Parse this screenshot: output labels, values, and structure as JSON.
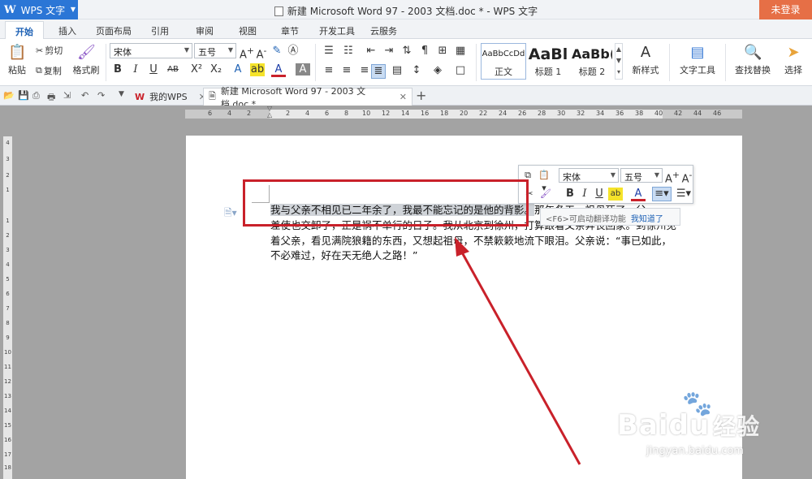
{
  "titlebar": {
    "app_name": "WPS 文字",
    "app_logo": "W",
    "doc_title": "新建 Microsoft Word 97 - 2003 文档.doc * - WPS 文字",
    "login": "未登录"
  },
  "menu": {
    "tabs": [
      "开始",
      "插入",
      "页面布局",
      "引用",
      "审阅",
      "视图",
      "章节",
      "开发工具",
      "云服务"
    ]
  },
  "ribbon": {
    "paste": "粘贴",
    "cut": "剪切",
    "copy": "复制",
    "format_painter": "格式刷",
    "font_name": "宋体",
    "font_size": "五号",
    "bold": "B",
    "italic": "I",
    "underline": "U",
    "styles": [
      {
        "preview": "AaBbCcDd",
        "name": "正文"
      },
      {
        "preview": "AaBl",
        "name": "标题 1"
      },
      {
        "preview": "AaBb(",
        "name": "标题 2"
      }
    ],
    "new_style": "新样式",
    "text_tools": "文字工具",
    "find_replace": "查找替换",
    "select": "选择"
  },
  "doc_tabs": [
    {
      "label": "我的WPS",
      "active": false
    },
    {
      "label": "新建 Microsoft Word 97 - 2003 文档.doc *",
      "active": true
    }
  ],
  "ruler": {
    "h_ticks": [
      "6",
      "4",
      "2",
      "",
      "2",
      "4",
      "6",
      "8",
      "10",
      "12",
      "14",
      "16",
      "18",
      "20",
      "22",
      "24",
      "26",
      "28",
      "30",
      "32",
      "34",
      "36",
      "38",
      "40",
      "42",
      "44",
      "46"
    ],
    "v_ticks": [
      "4",
      "3",
      "2",
      "1",
      "",
      "1",
      "2",
      "3",
      "4",
      "5",
      "6",
      "7",
      "8",
      "9",
      "10",
      "11",
      "12",
      "13",
      "14",
      "15",
      "16",
      "17",
      "18",
      "19"
    ]
  },
  "document": {
    "line1_selected": "我与父亲不相见已二年余了，我最不能忘记的是他的背影。",
    "line1_rest": "那年冬天，祖母死了，父",
    "line2": "差使也交卸了，正是祸不单行的日子。我从北京到徐州，打算跟着父亲奔丧回家。到徐州见",
    "line3": "着父亲，看见满院狼籍的东西，又想起祖母，不禁簌簌地流下眼泪。父亲说：“事已如此，",
    "line4": "不必难过，好在天无绝人之路！”"
  },
  "mini_toolbar": {
    "font_name": "宋体",
    "font_size": "五号"
  },
  "tip": {
    "text": "<F6>可启动翻译功能",
    "link": "我知道了"
  },
  "watermark": {
    "brand": "Bai",
    "brand2": "du",
    "cn": "经验",
    "url": "jingyan.baidu.com"
  },
  "colors": {
    "app_blue": "#2b76d6",
    "login_orange": "#e66f46",
    "annotation_red": "#c9212a"
  }
}
